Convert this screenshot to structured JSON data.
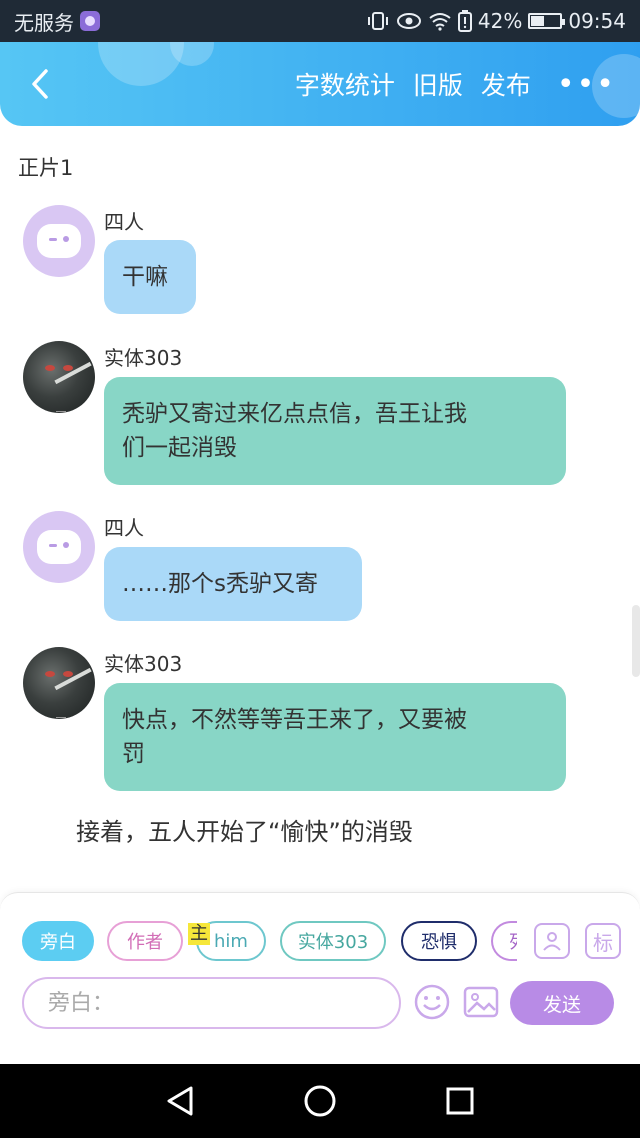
{
  "status_bar": {
    "carrier": "无服务",
    "battery": "42%",
    "battery_level": 0.42,
    "time": "09:54"
  },
  "header": {
    "word_count": "字数统计",
    "old_version": "旧版",
    "publish": "发布",
    "more": "•••"
  },
  "section_title": "正片1",
  "messages": [
    {
      "name": "四人",
      "text": "干嘛"
    },
    {
      "name": "实体303",
      "text_line1": "秃驴又寄过来亿点点信，吾王让我",
      "text_line2": "们一起消毁"
    },
    {
      "name": "四人",
      "text": "……那个s秃驴又寄"
    },
    {
      "name": "实体303",
      "text_line1": "快点，不然等等吾王来了，又要被",
      "text_line2": "罚"
    }
  ],
  "narration": "接着，五人开始了“愉快”的消毁",
  "input_panel": {
    "chips": {
      "narrator": "旁白",
      "author": "作者",
      "main_badge": "主",
      "him": "him",
      "entity": "实体303",
      "fear": "恐惧",
      "partial": "列"
    },
    "tag_icon_label": "标",
    "placeholder": "旁白：",
    "send": "发送"
  },
  "colors": {
    "header_start": "#56c6f4",
    "header_end": "#2f9ff0",
    "bubble_blue": "#aad9f8",
    "bubble_teal": "#88d6c6",
    "send_button": "#b88be6"
  }
}
